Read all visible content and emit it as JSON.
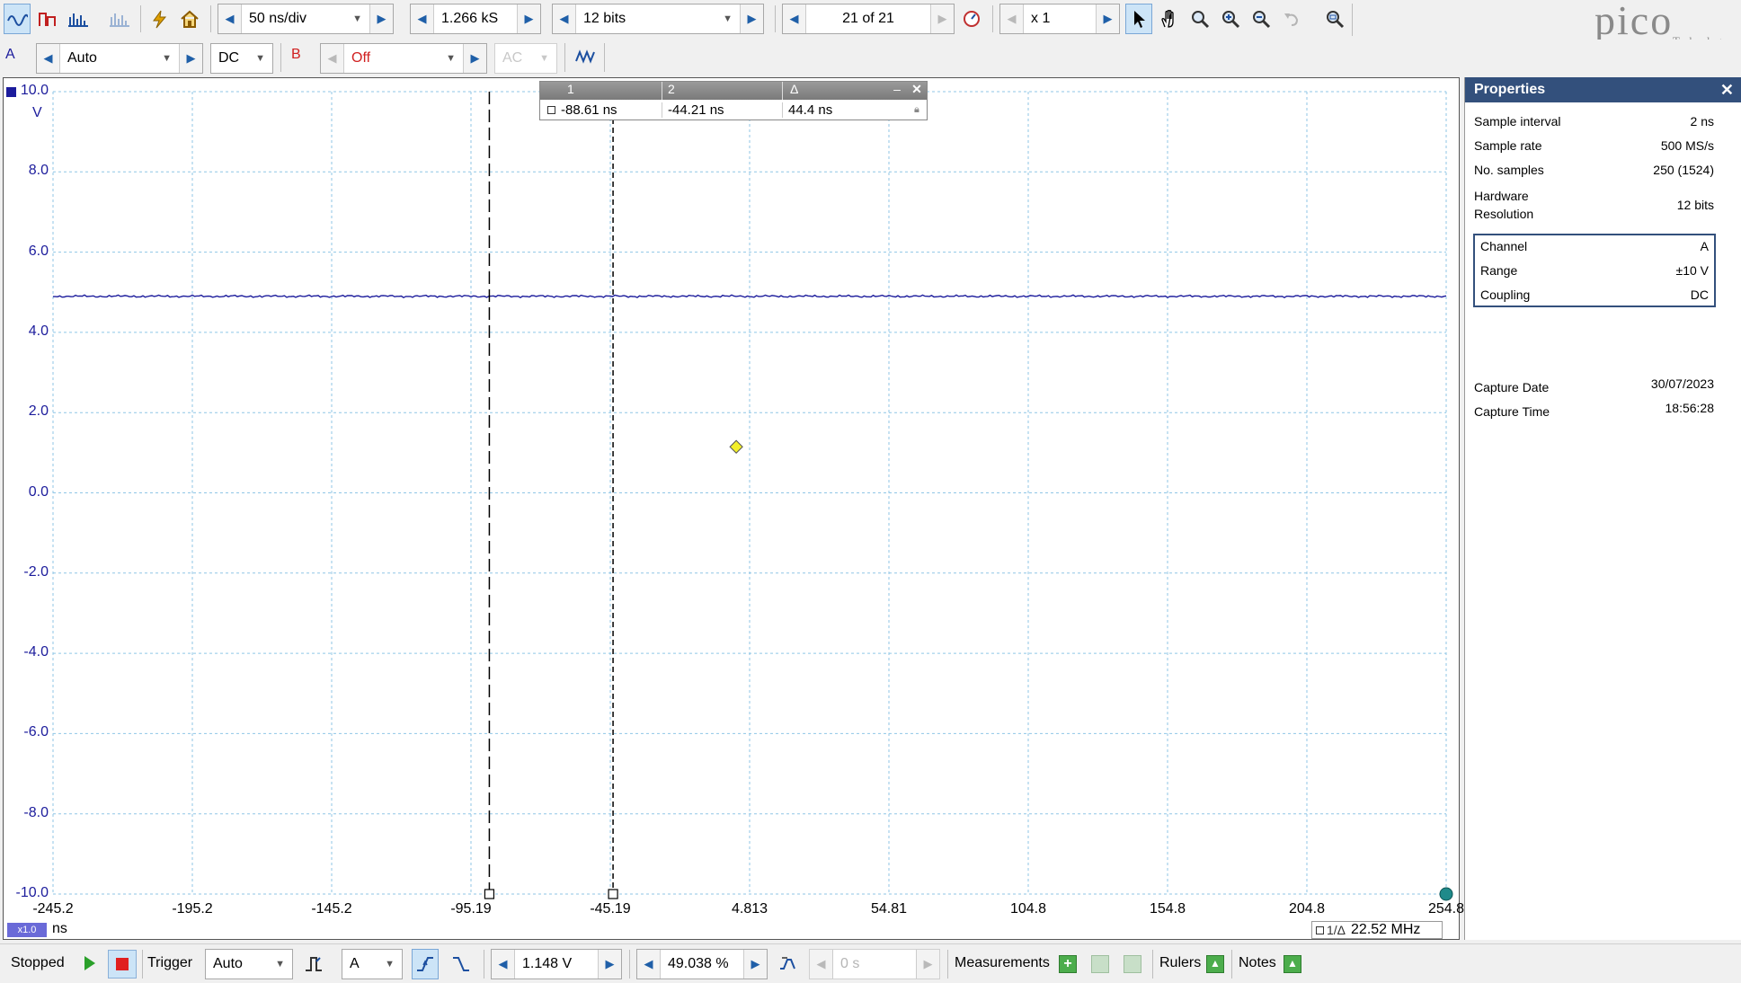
{
  "toolbar1": {
    "timebase": "50 ns/div",
    "samples": "1.266 kS",
    "resolution": "12 bits",
    "buffer": "21 of 21",
    "zoom": "x 1"
  },
  "toolbar2": {
    "channel_a": "A",
    "range_a": "Auto",
    "coupling_a": "DC",
    "channel_b": "B",
    "range_b": "Off",
    "coupling_b": "AC"
  },
  "brand": {
    "logo_text": "pico",
    "logo_sub": "Technology"
  },
  "plot": {
    "y_unit": "V",
    "y_ticks": [
      "10.0",
      "8.0",
      "6.0",
      "4.0",
      "2.0",
      "0.0",
      "-2.0",
      "-4.0",
      "-6.0",
      "-8.0",
      "-10.0"
    ],
    "x_ticks": [
      "-245.2",
      "-195.2",
      "-145.2",
      "-95.19",
      "-45.19",
      "4.813",
      "54.81",
      "104.8",
      "154.8",
      "204.8",
      "254.8"
    ],
    "x_unit": "ns",
    "x_zoom_badge": "x1.0",
    "frequency_readout": "1/Δ",
    "frequency_value": "22.52 MHz",
    "trace_color": "#1c1c9c"
  },
  "chart_data": {
    "type": "line",
    "title": "",
    "xlabel": "ns",
    "ylabel": "V",
    "xlim": [
      -245.2,
      254.8
    ],
    "ylim": [
      -10,
      10
    ],
    "grid": true,
    "series": [
      {
        "name": "A",
        "x": [
          -245.2,
          254.8
        ],
        "y": [
          4.9,
          4.9
        ]
      }
    ],
    "rulers": [
      -88.61,
      -44.21
    ],
    "trigger_marker": {
      "x": 0,
      "y": 1.148
    }
  },
  "ruler_box": {
    "h1": "1",
    "h2": "2",
    "h3": "Δ",
    "v1": "-88.61 ns",
    "v2": "-44.21 ns",
    "v3": "44.4 ns"
  },
  "properties": {
    "title": "Properties",
    "rows": [
      {
        "label": "Sample interval",
        "value": "2 ns"
      },
      {
        "label": "Sample rate",
        "value": "500 MS/s"
      },
      {
        "label": "No. samples",
        "value": "250  (1524)"
      },
      {
        "label": "Hardware Resolution",
        "value": "12 bits"
      }
    ],
    "channel_rows": [
      {
        "label": "Channel",
        "value": "A"
      },
      {
        "label": "Range",
        "value": "±10 V"
      },
      {
        "label": "Coupling",
        "value": "DC"
      }
    ],
    "capture_rows": [
      {
        "label": "Capture Date",
        "value": "30/07/2023"
      },
      {
        "label": "Capture Time",
        "value": "18:56:28"
      }
    ]
  },
  "statusbar": {
    "state": "Stopped",
    "trigger_label": "Trigger",
    "trigger_mode": "Auto",
    "trigger_channel": "A",
    "trigger_level": "1.148 V",
    "pretrigger": "49.038 %",
    "delay": "0 s",
    "measurements": "Measurements",
    "rulers": "Rulers",
    "notes": "Notes"
  }
}
